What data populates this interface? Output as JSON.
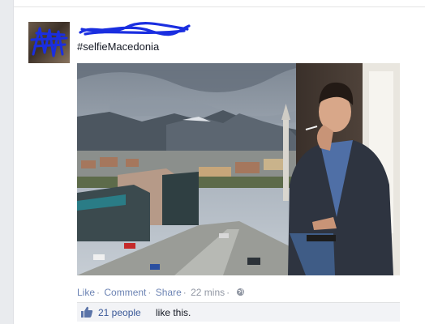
{
  "post": {
    "author_name": "",
    "hashtag": "#selfieMacedonia",
    "actions": {
      "like": "Like",
      "comment": "Comment",
      "share": "Share",
      "separator": "·",
      "timestamp": "22 mins",
      "audience_icon": "globe-icon"
    },
    "likes": {
      "icon": "thumbs-up-icon",
      "count_text": "21 people",
      "suffix_text": "like this."
    }
  },
  "colors": {
    "link": "#3b5998",
    "action_link": "#6d84b4",
    "meta": "#9197a3",
    "redaction": "#1a2ee0"
  }
}
